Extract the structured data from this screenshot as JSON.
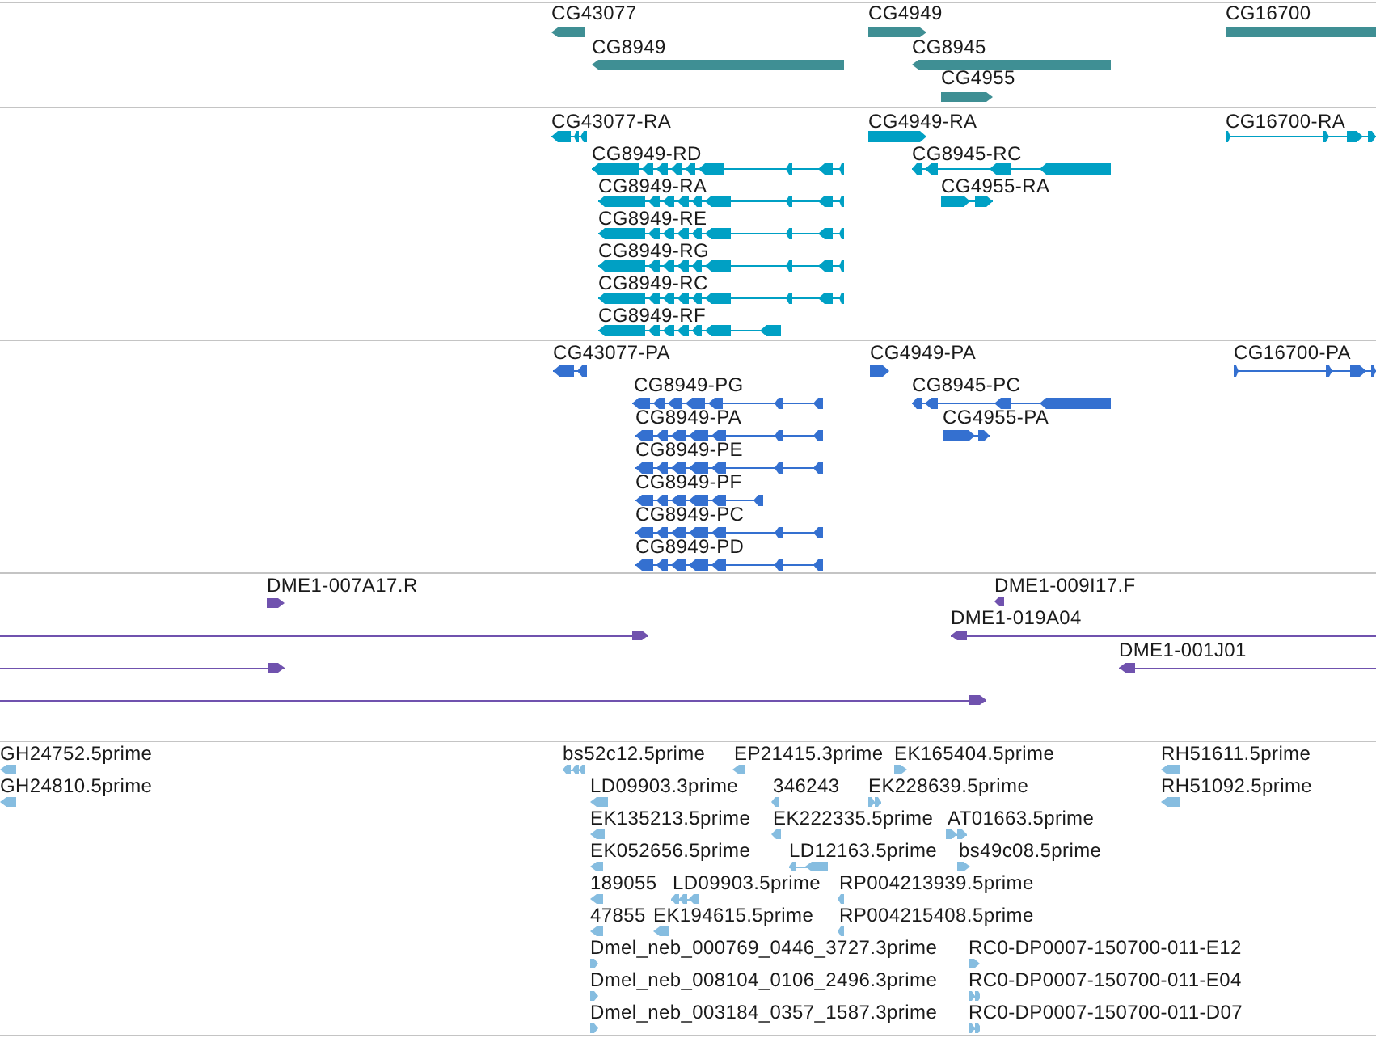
{
  "tracks": [
    {
      "kind": "gene",
      "features": [
        {
          "label": "CG43077",
          "reverse": true
        },
        {
          "label": "CG8949",
          "reverse": true
        },
        {
          "label": "CG4949",
          "reverse": false
        },
        {
          "label": "CG8945",
          "reverse": true
        },
        {
          "label": "CG4955",
          "reverse": false
        },
        {
          "label": "CG16700"
        }
      ]
    },
    {
      "kind": "transcript",
      "features": [
        {
          "label": "CG43077-RA",
          "reverse": true
        },
        {
          "label": "CG8949-RD",
          "reverse": true
        },
        {
          "label": "CG8949-RA",
          "reverse": true
        },
        {
          "label": "CG8949-RE",
          "reverse": true
        },
        {
          "label": "CG8949-RG",
          "reverse": true
        },
        {
          "label": "CG8949-RC",
          "reverse": true
        },
        {
          "label": "CG8949-RF",
          "reverse": true
        },
        {
          "label": "CG4949-RA",
          "reverse": false
        },
        {
          "label": "CG8945-RC",
          "reverse": true
        },
        {
          "label": "CG4955-RA",
          "reverse": false
        },
        {
          "label": "CG16700-RA",
          "reverse": false
        }
      ]
    },
    {
      "kind": "protein",
      "features": [
        {
          "label": "CG43077-PA",
          "reverse": true
        },
        {
          "label": "CG8949-PG",
          "reverse": true
        },
        {
          "label": "CG8949-PA",
          "reverse": true
        },
        {
          "label": "CG8949-PE",
          "reverse": true
        },
        {
          "label": "CG8949-PF",
          "reverse": true
        },
        {
          "label": "CG8949-PC",
          "reverse": true
        },
        {
          "label": "CG8949-PD",
          "reverse": true
        },
        {
          "label": "CG4949-PA",
          "reverse": false
        },
        {
          "label": "CG8945-PC",
          "reverse": true
        },
        {
          "label": "CG4955-PA",
          "reverse": false
        },
        {
          "label": "CG16700-PA",
          "reverse": false
        }
      ]
    },
    {
      "kind": "clone",
      "features": [
        {
          "label": "DME1-007A17.R",
          "reverse": false
        },
        {
          "label": "DME1-009I17.F",
          "reverse": true
        },
        {
          "reverse": false
        },
        {
          "label": "DME1-019A04",
          "reverse": true
        },
        {
          "reverse": false
        },
        {
          "label": "DME1-001J01",
          "reverse": true
        },
        {
          "reverse": false
        }
      ]
    },
    {
      "kind": "est",
      "features": [
        {
          "label": "GH24752.5prime",
          "reverse": true
        },
        {
          "label": "bs52c12.5prime",
          "reverse": true
        },
        {
          "label": "EP21415.3prime",
          "reverse": true
        },
        {
          "label": "EK165404.5prime",
          "reverse": false
        },
        {
          "label": "RH51611.5prime",
          "reverse": true
        },
        {
          "label": "GH24810.5prime",
          "reverse": true
        },
        {
          "label": "LD09903.3prime",
          "reverse": true
        },
        {
          "label": "346243",
          "reverse": true
        },
        {
          "label": "EK228639.5prime",
          "reverse": false
        },
        {
          "label": "RH51092.5prime",
          "reverse": true
        },
        {
          "label": "EK135213.5prime",
          "reverse": true
        },
        {
          "label": "EK222335.5prime",
          "reverse": true
        },
        {
          "label": "AT01663.5prime",
          "reverse": false
        },
        {
          "label": "EK052656.5prime",
          "reverse": true
        },
        {
          "label": "LD12163.5prime",
          "reverse": true
        },
        {
          "label": "bs49c08.5prime",
          "reverse": false
        },
        {
          "label": "189055",
          "reverse": true
        },
        {
          "label": "LD09903.5prime",
          "reverse": true
        },
        {
          "label": "RP004213939.5prime",
          "reverse": true
        },
        {
          "label": "47855",
          "reverse": true
        },
        {
          "label": "EK194615.5prime",
          "reverse": true
        },
        {
          "label": "RP004215408.5prime",
          "reverse": true
        },
        {
          "label": "Dmel_neb_000769_0446_3727.3prime",
          "reverse": false
        },
        {
          "label": "RC0-DP0007-150700-011-E12",
          "reverse": false
        },
        {
          "label": "Dmel_neb_008104_0106_2496.3prime",
          "reverse": false
        },
        {
          "label": "RC0-DP0007-150700-011-E04",
          "reverse": false
        },
        {
          "label": "Dmel_neb_003184_0357_1587.3prime",
          "reverse": false
        },
        {
          "label": "RC0-DP0007-150700-011-D07",
          "reverse": false
        }
      ]
    }
  ]
}
